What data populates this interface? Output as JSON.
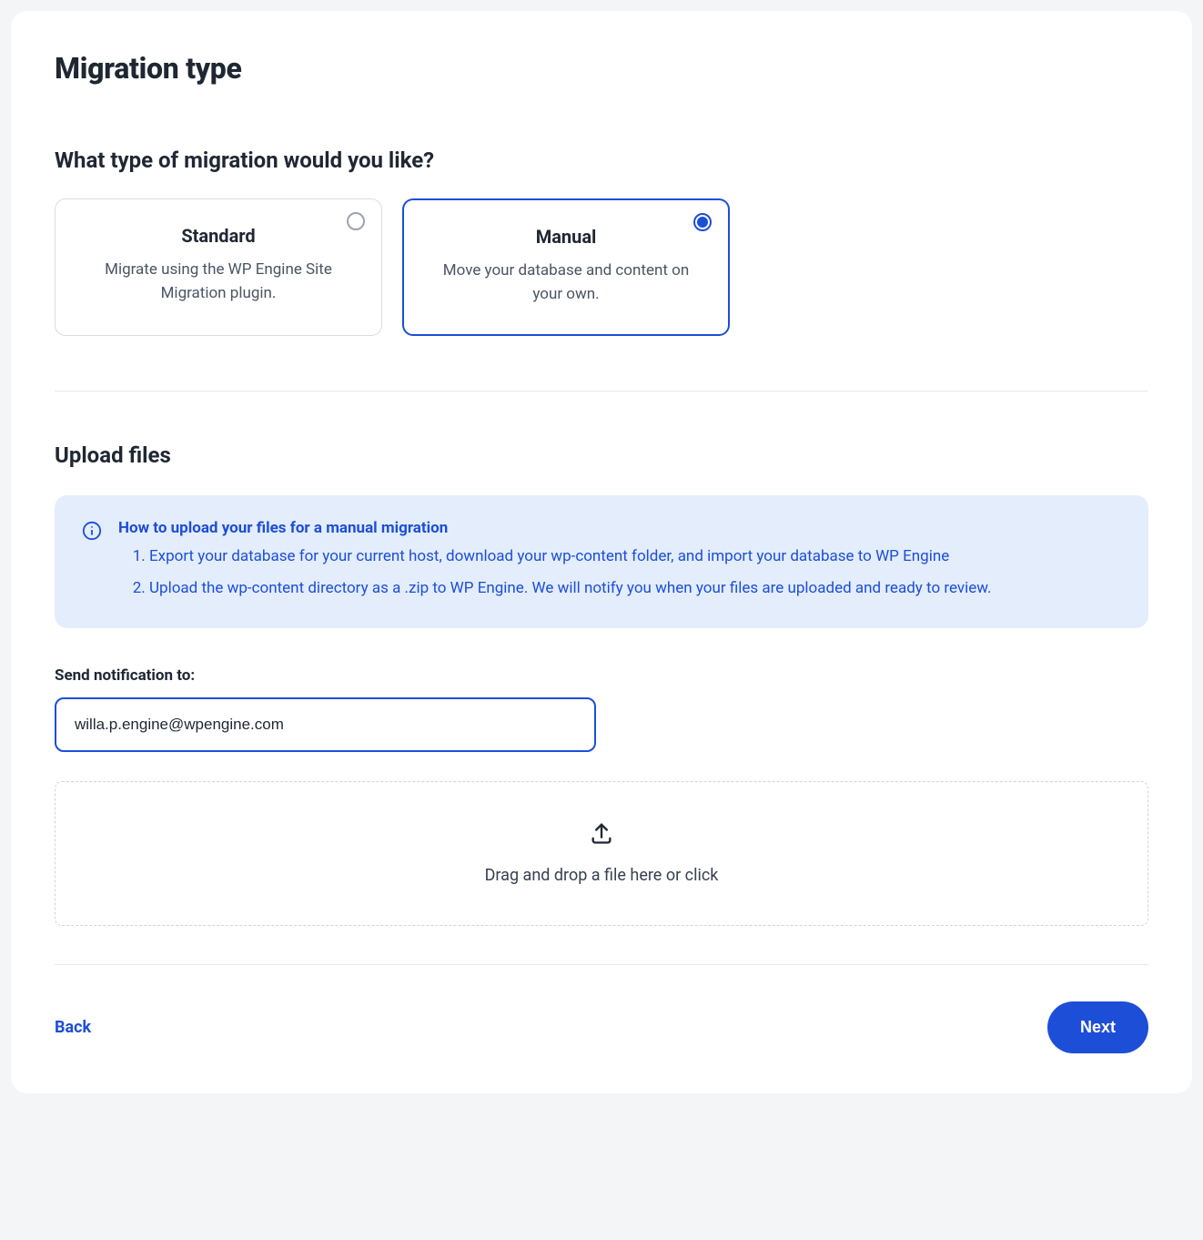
{
  "title": "Migration type",
  "question": "What type of migration would you like?",
  "options": {
    "standard": {
      "title": "Standard",
      "desc": "Migrate using the WP Engine Site Migration plugin.",
      "selected": false
    },
    "manual": {
      "title": "Manual",
      "desc": "Move your database and content on your own.",
      "selected": true
    }
  },
  "upload": {
    "heading": "Upload files",
    "info_title": "How to upload your files for a manual migration",
    "steps": [
      "Export your database for your current host, download your wp-content folder, and import your database to WP Engine",
      "Upload the wp-content directory as a .zip to WP Engine. We will notify you when your files are uploaded and ready to review."
    ],
    "notify_label": "Send notification to:",
    "notify_value": "willa.p.engine@wpengine.com",
    "dropzone_text": "Drag and drop a file here or click"
  },
  "footer": {
    "back": "Back",
    "next": "Next"
  }
}
